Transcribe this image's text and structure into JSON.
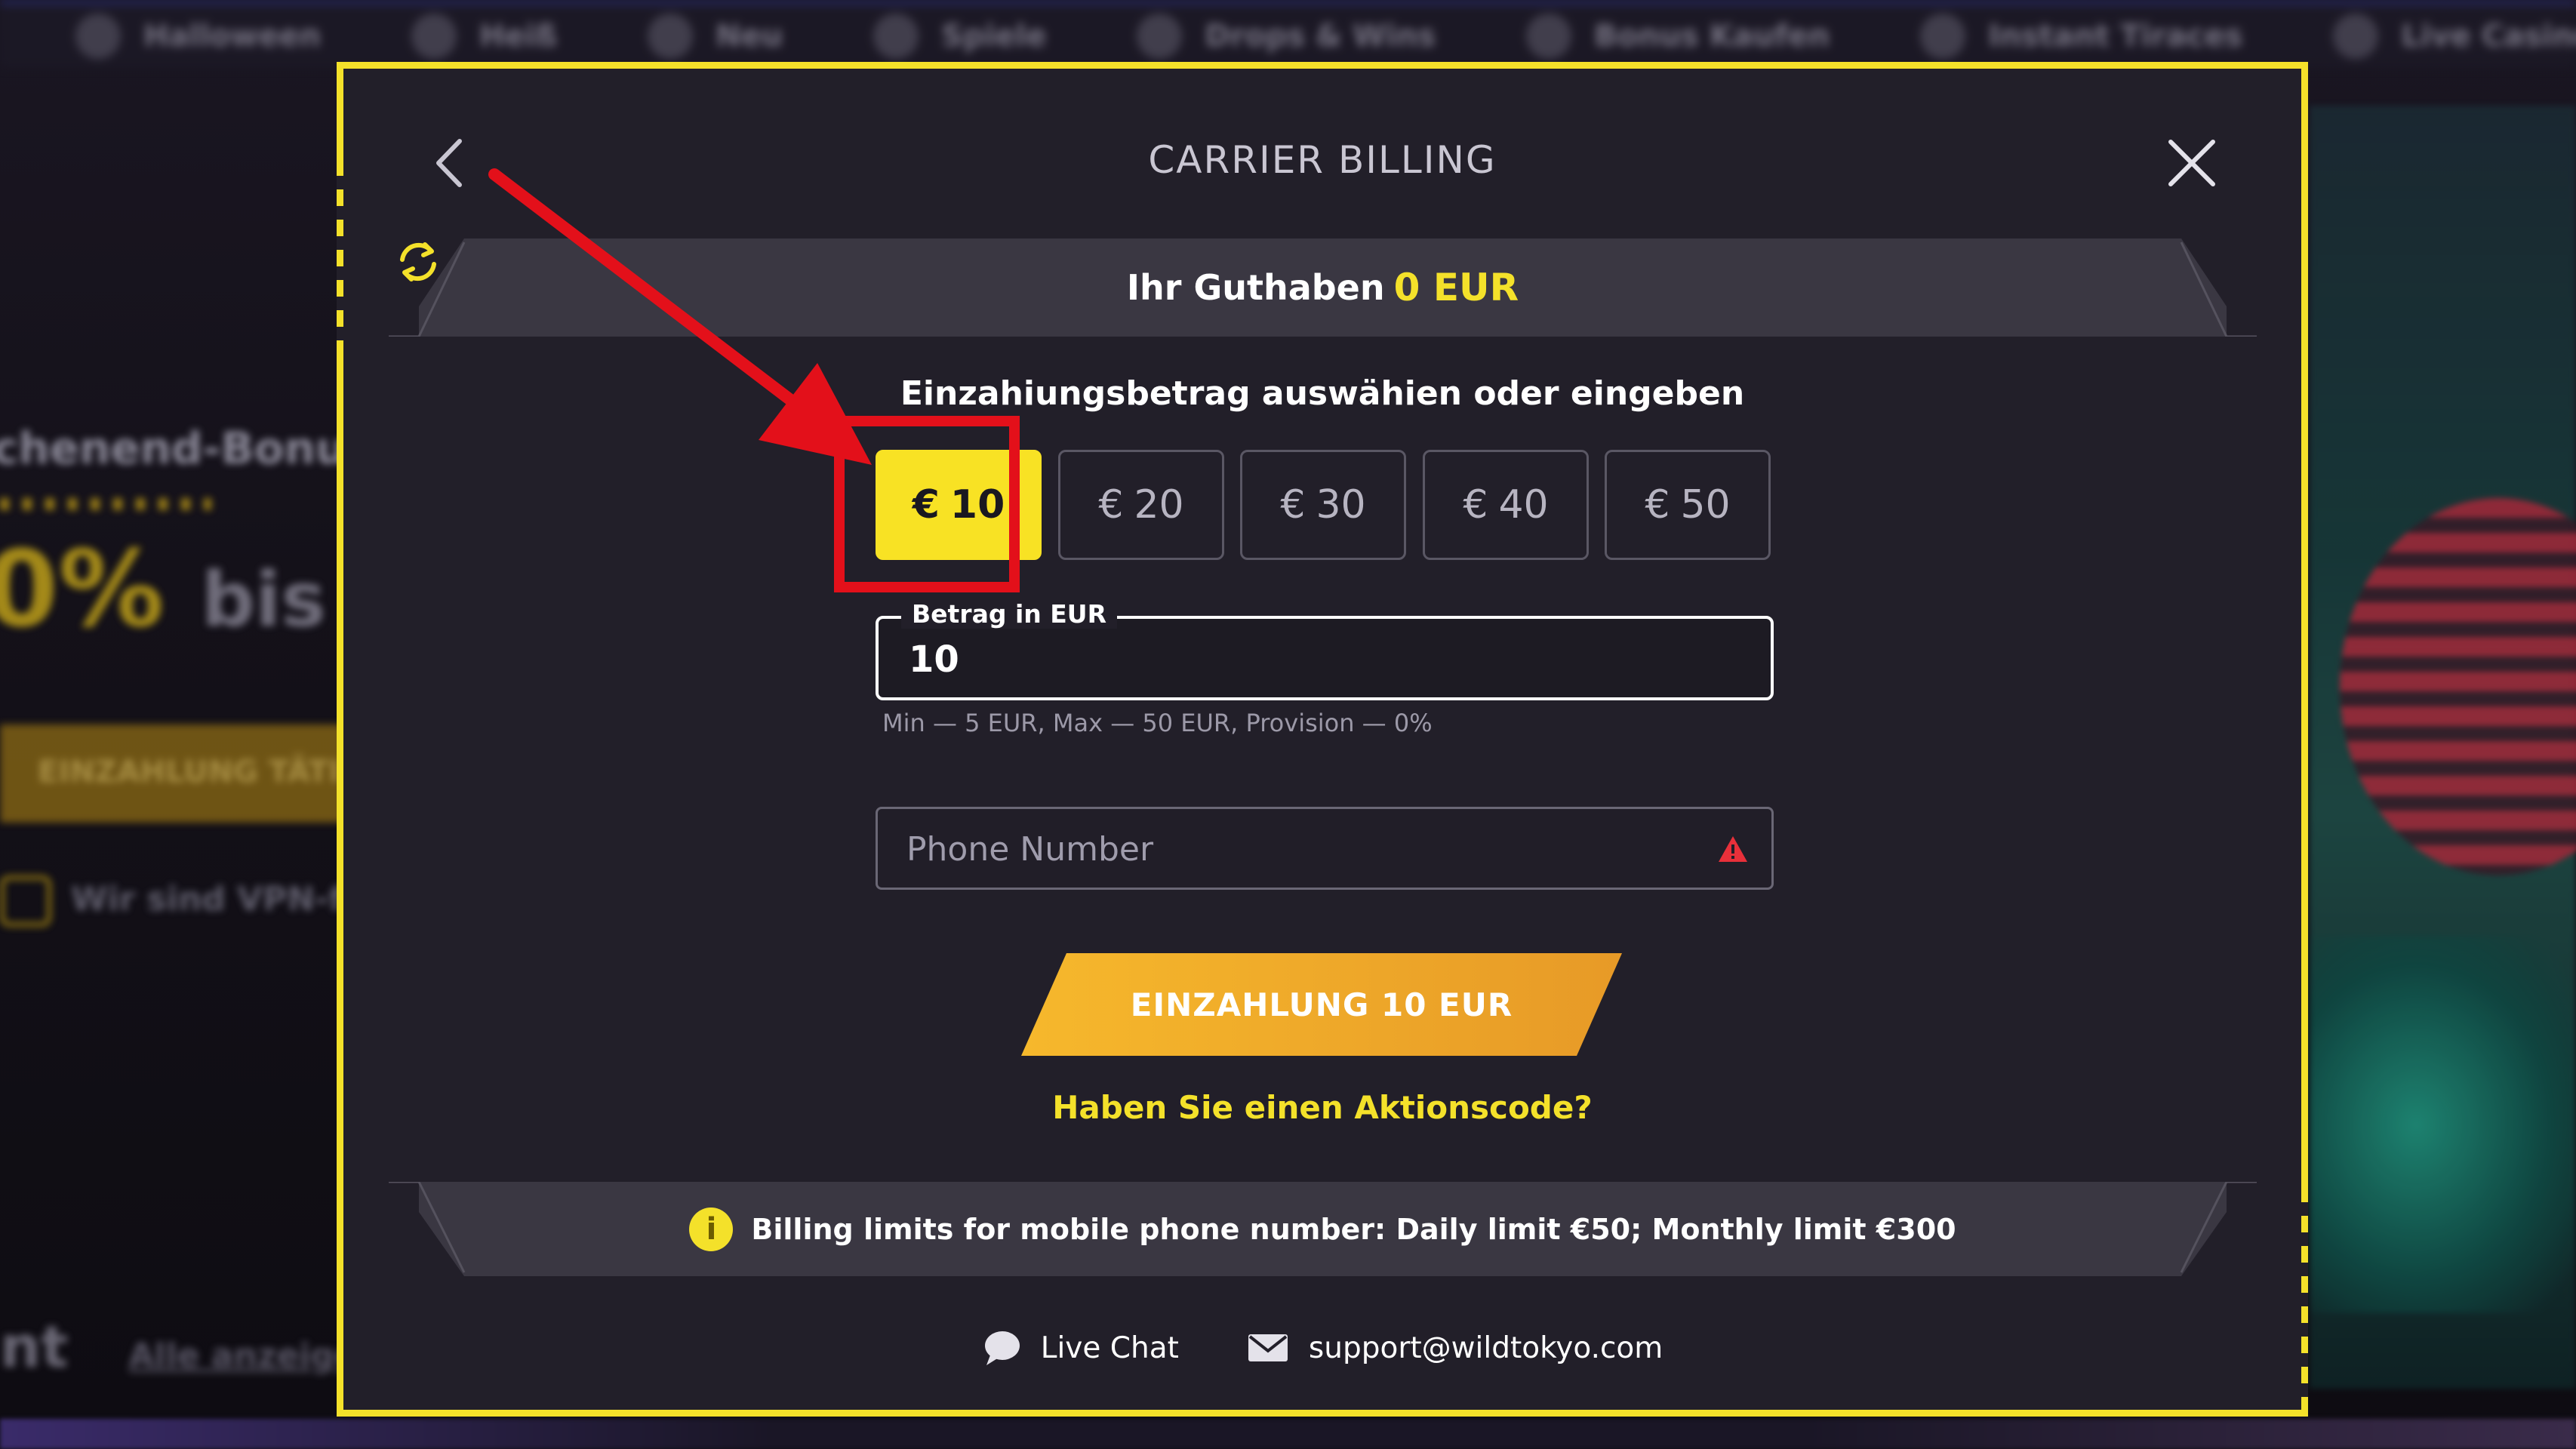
{
  "background": {
    "nav": [
      {
        "label": "Halloween",
        "icon": "pumpkin-icon"
      },
      {
        "label": "Heiß",
        "icon": "flame-icon"
      },
      {
        "label": "Neu",
        "icon": "sparkle-icon"
      },
      {
        "label": "Spiele",
        "icon": "gamepad-icon"
      },
      {
        "label": "Drops & Wins",
        "icon": "coins-icon"
      },
      {
        "label": "Bonus Kaufen",
        "icon": "gift-icon"
      },
      {
        "label": "Instant Tiraces",
        "icon": "target-icon"
      },
      {
        "label": "Live Casino",
        "icon": "cards-icon"
      }
    ],
    "promo_title": "chenend-Bonus",
    "promo_percent": "0%",
    "promo_suffix": "bis zu",
    "promo_button": "EINZAHLUNG TÄTI",
    "vpn_note": "Wir sind VPN-fre",
    "section_tail": "nt",
    "show_all": "Alle anzeigen"
  },
  "modal": {
    "title": "CARRIER BILLING",
    "balance_label": "Ihr Guthaben",
    "balance_amount": "0 EUR",
    "amount_heading": "Einzahiungsbetrag auswähien oder eingeben",
    "currency_symbol": "€",
    "amounts": [
      "10",
      "20",
      "30",
      "40",
      "50"
    ],
    "selected_amount_index": 0,
    "amount_field_label": "Betrag in EUR",
    "amount_field_value": "10",
    "amount_hint": "Min — 5 EUR, Max — 50 EUR, Provision — 0%",
    "phone_placeholder": "Phone Number",
    "deposit_button": "EINZAHLUNG 10 EUR",
    "promo_link": "Haben Sie einen Aktionscode?",
    "limits_text": "Billing limits for mobile phone number: Daily limit €50; Monthly limit €300",
    "info_icon_text": "i",
    "live_chat": "Live Chat",
    "support_email": "support@wildtokyo.com"
  },
  "colors": {
    "accent_yellow": "#f4e12a",
    "button_orange": "#f0a92a",
    "highlight_red": "#e3101a",
    "modal_bg": "#221f29"
  }
}
